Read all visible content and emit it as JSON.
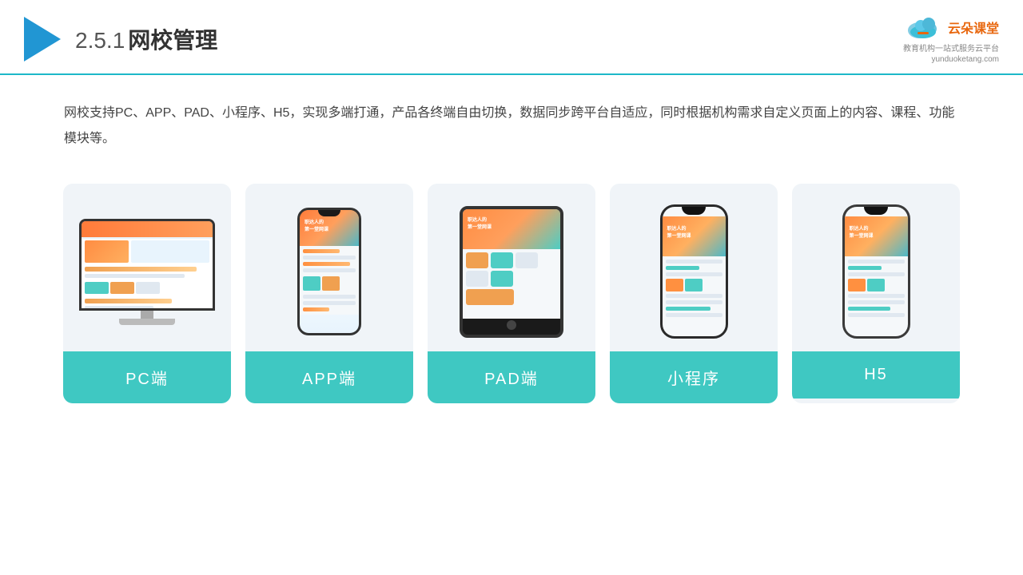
{
  "header": {
    "section_num": "2.5.1",
    "title": "网校管理",
    "brand_name": "云朵课堂",
    "brand_tagline": "教育机构一站式服务云平台",
    "brand_url": "yunduoketang.com"
  },
  "description": {
    "text": "网校支持PC、APP、PAD、小程序、H5，实现多端打通，产品各终端自由切换，数据同步跨平台自适应，同时根据机构需求自定义页面上的内容、课程、功能模块等。"
  },
  "cards": [
    {
      "id": "pc",
      "label": "PC端"
    },
    {
      "id": "app",
      "label": "APP端"
    },
    {
      "id": "pad",
      "label": "PAD端"
    },
    {
      "id": "miniprogram",
      "label": "小程序"
    },
    {
      "id": "h5",
      "label": "H5"
    }
  ],
  "colors": {
    "accent_teal": "#3fc8c2",
    "header_line": "#1db8c8",
    "text_main": "#444",
    "blue_arrow": "#2196d3"
  }
}
